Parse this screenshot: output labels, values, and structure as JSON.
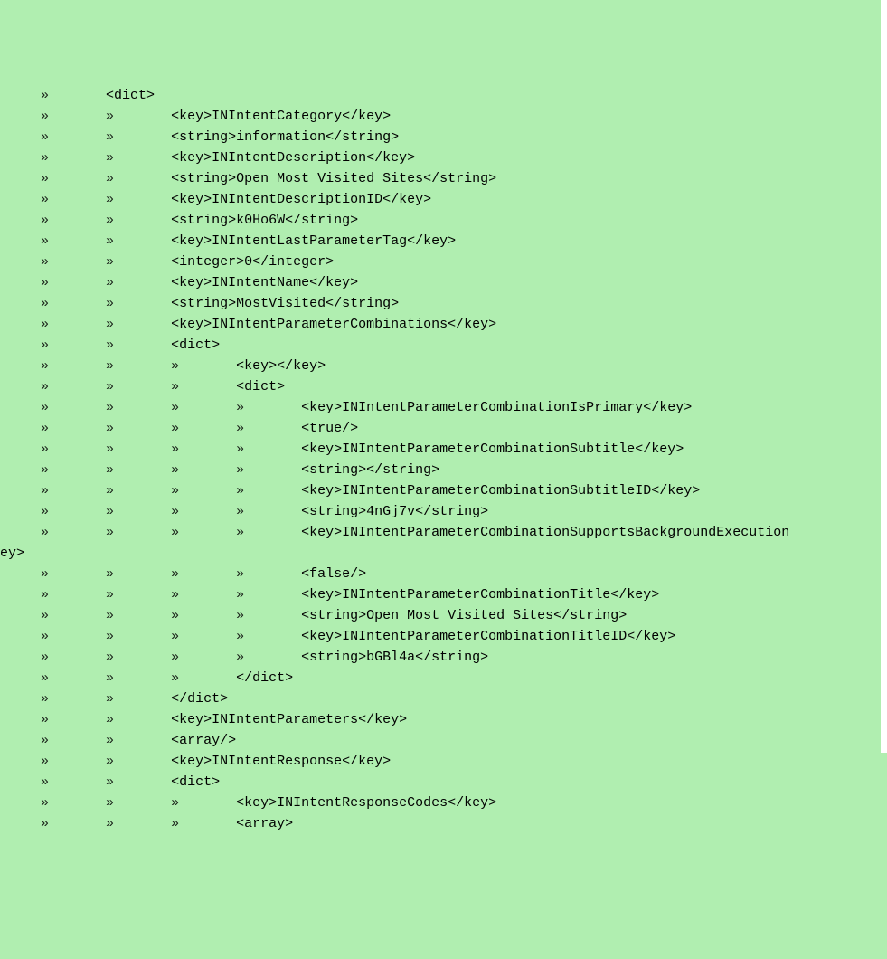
{
  "glyph": "»",
  "lines": [
    {
      "tabs": 1,
      "text": "<dict>"
    },
    {
      "tabs": 2,
      "text": "<key>INIntentCategory</key>"
    },
    {
      "tabs": 2,
      "text": "<string>information</string>"
    },
    {
      "tabs": 2,
      "text": "<key>INIntentDescription</key>"
    },
    {
      "tabs": 2,
      "text": "<string>Open Most Visited Sites</string>"
    },
    {
      "tabs": 2,
      "text": "<key>INIntentDescriptionID</key>"
    },
    {
      "tabs": 2,
      "text": "<string>k0Ho6W</string>"
    },
    {
      "tabs": 2,
      "text": "<key>INIntentLastParameterTag</key>"
    },
    {
      "tabs": 2,
      "text": "<integer>0</integer>"
    },
    {
      "tabs": 2,
      "text": "<key>INIntentName</key>"
    },
    {
      "tabs": 2,
      "text": "<string>MostVisited</string>"
    },
    {
      "tabs": 2,
      "text": "<key>INIntentParameterCombinations</key>"
    },
    {
      "tabs": 2,
      "text": "<dict>"
    },
    {
      "tabs": 3,
      "text": "<key></key>"
    },
    {
      "tabs": 3,
      "text": "<dict>"
    },
    {
      "tabs": 4,
      "text": "<key>INIntentParameterCombinationIsPrimary</key>"
    },
    {
      "tabs": 4,
      "text": "<true/>"
    },
    {
      "tabs": 4,
      "text": "<key>INIntentParameterCombinationSubtitle</key>"
    },
    {
      "tabs": 4,
      "text": "<string></string>"
    },
    {
      "tabs": 4,
      "text": "<key>INIntentParameterCombinationSubtitleID</key>"
    },
    {
      "tabs": 4,
      "text": "<string>4nGj7v</string>"
    },
    {
      "tabs": 4,
      "text": "<key>INIntentParameterCombinationSupportsBackgroundExecution",
      "wrap": "ey>"
    },
    {
      "tabs": 4,
      "text": "<false/>"
    },
    {
      "tabs": 4,
      "text": "<key>INIntentParameterCombinationTitle</key>"
    },
    {
      "tabs": 4,
      "text": "<string>Open Most Visited Sites</string>"
    },
    {
      "tabs": 4,
      "text": "<key>INIntentParameterCombinationTitleID</key>"
    },
    {
      "tabs": 4,
      "text": "<string>bGBl4a</string>"
    },
    {
      "tabs": 3,
      "text": "</dict>"
    },
    {
      "tabs": 2,
      "text": "</dict>"
    },
    {
      "tabs": 2,
      "text": "<key>INIntentParameters</key>"
    },
    {
      "tabs": 2,
      "text": "<array/>"
    },
    {
      "tabs": 2,
      "text": "<key>INIntentResponse</key>"
    },
    {
      "tabs": 2,
      "text": "<dict>"
    },
    {
      "tabs": 3,
      "text": "<key>INIntentResponseCodes</key>"
    },
    {
      "tabs": 3,
      "text": "<array>"
    }
  ]
}
